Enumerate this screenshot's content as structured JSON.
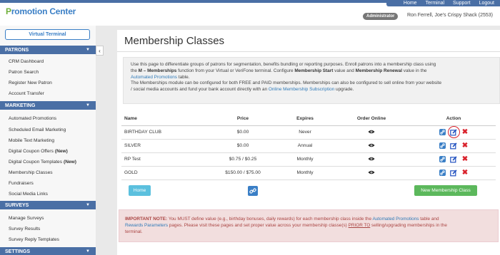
{
  "header": {
    "brand": "Promotion Center",
    "nav": [
      "Home",
      "Terminal",
      "Support",
      "Logout"
    ],
    "role_badge": "Administrator",
    "user": "Ron Ferrell, Joe's Crispy Shack (2553)"
  },
  "sidebar": {
    "virtual_terminal": "Virtual Terminal",
    "sections": {
      "patrons": "PATRONS",
      "marketing": "MARKETING",
      "surveys": "SURVEYS",
      "settings": "SETTINGS"
    },
    "patrons_items": [
      "CRM Dashboard",
      "Patron Search",
      "Register New Patron",
      "Account Transfer"
    ],
    "marketing_items": [
      "Automated Promotions",
      "Scheduled Email Marketing",
      "Mobile Text Marketing",
      "Digital Coupon Offers",
      "Digital Coupon Templates",
      "Membership Classes",
      "Fundraisers",
      "Social Media Links"
    ],
    "new_tag": "(New)",
    "surveys_items": [
      "Manage Surveys",
      "Survey Results",
      "Survey Reply Templates"
    ]
  },
  "main": {
    "title": "Membership Classes",
    "info": {
      "l1": "Use this page to differentiate groups of patrons for segmentation, benefits bundling or reporting purposes. Enroll patrons into a membership class using",
      "l2_pre": "the ",
      "l2_bold1": "M – Memberships",
      "l2_mid": " function from your Virtual or VeriFone terminal. Configure ",
      "l2_bold2": "Membership Start",
      "l2_mid2": " value and ",
      "l2_bold3": "Membership Renewal",
      "l2_post": " value in the",
      "l3_link": "Automated Promotions",
      "l3_post": " table.",
      "l4": "The Memberships module can be configured for both FREE and PAID memberships. Memberships can also be configured to sell online from your website",
      "l5_pre": "/ social media accounts and fund your bank account directly with an ",
      "l5_link": "Online Membership Subscription",
      "l5_post": " upgrade."
    },
    "table": {
      "headers": [
        "Name",
        "Price",
        "Expires",
        "Order Online",
        "Action"
      ],
      "rows": [
        {
          "name": "BIRTHDAY CLUB",
          "price": "$0.00",
          "expires": "Never"
        },
        {
          "name": "SILVER",
          "price": "$0.00",
          "expires": "Annual"
        },
        {
          "name": "RP Test",
          "price": "$0.75 / $0.25",
          "expires": "Monthly"
        },
        {
          "name": "GOLD",
          "price": "$150.00 / $75.00",
          "expires": "Monthly"
        }
      ]
    },
    "buttons": {
      "home": "Home",
      "new_class": "New Membership Class"
    },
    "notice": {
      "label": "IMPORTANT NOTE:",
      "t1": " You MUST define value (e.g., birthday bonuses, daily rewards) for each membership class inside the ",
      "link1": "Automated Promotions",
      "t2": " table and",
      "link2": "Rewards Parameters",
      "t3": " pages. Please visit these pages and set proper value across your membership classe(s) ",
      "ul": "PRIOR TO",
      "t4": " selling/upgrading memberships in the",
      "t5": "terminal."
    }
  },
  "colors": {
    "brand_blue": "#4a6fa5",
    "link_blue": "#3a7fc6",
    "success_green": "#5cb85c",
    "info_cyan": "#5bc0de",
    "danger_red": "#d9232d"
  }
}
